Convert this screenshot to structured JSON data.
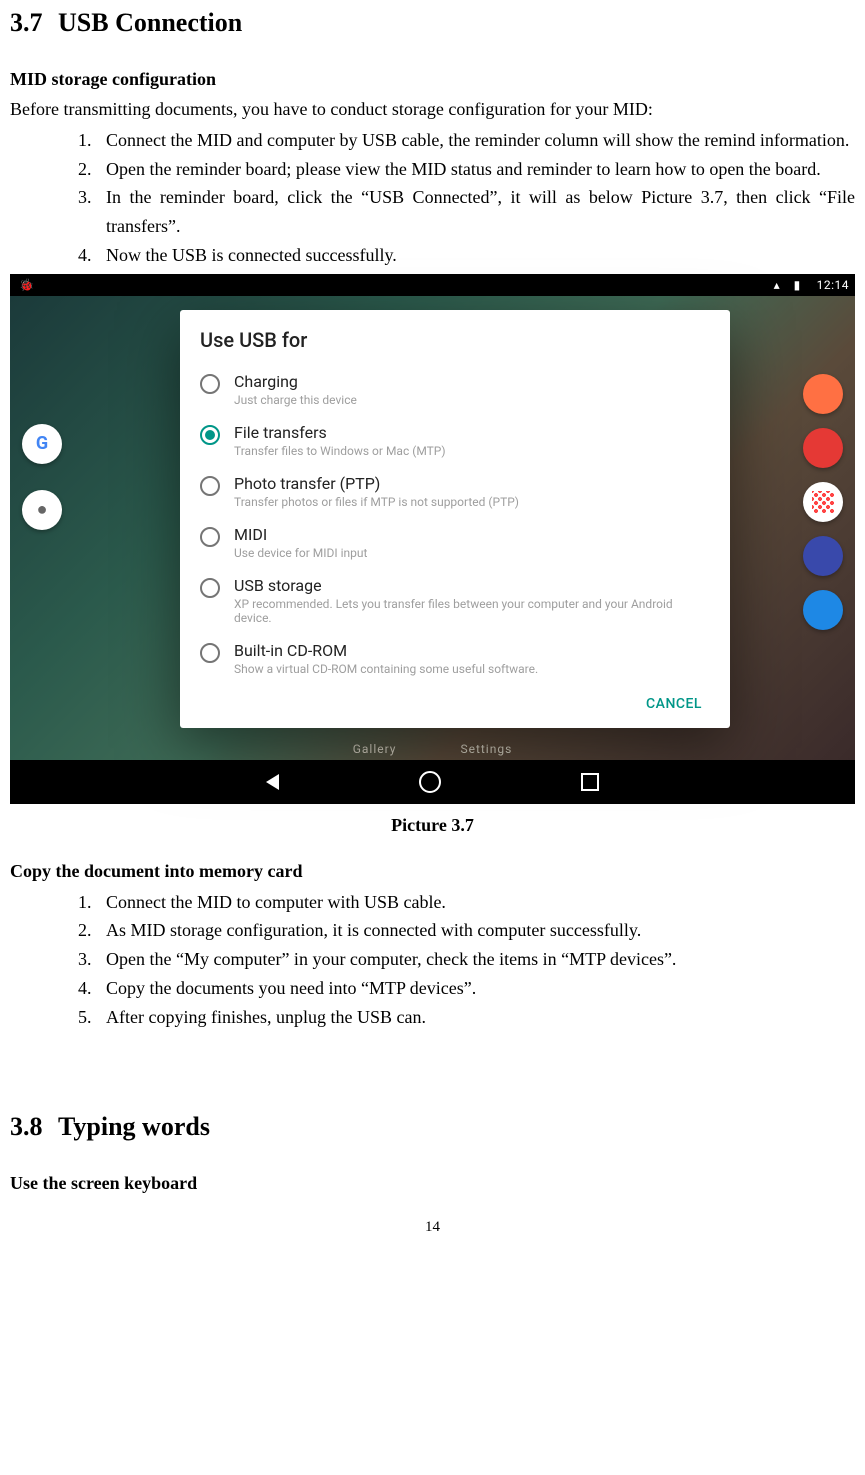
{
  "sec37": {
    "number": "3.7",
    "title": "USB Connection",
    "subhead1": "MID storage configuration",
    "intro": "Before transmitting documents, you have to conduct storage configuration for your MID:",
    "list1": [
      "Connect the MID and computer by USB cable, the reminder column will show the remind information.",
      "Open the reminder board; please view the MID status and reminder to learn how to open the board.",
      "In the reminder board, click the “USB Connected”, it will as below Picture 3.7, then click “File transfers”.",
      "Now the USB is connected successfully."
    ],
    "caption": "Picture 3.7",
    "subhead2": "Copy the document into memory card",
    "list2": [
      "Connect the MID to computer with USB cable.",
      "As MID storage configuration, it is connected with computer successfully.",
      "Open the “My computer” in your computer, check the items in “MTP devices”.",
      "Copy the documents you need into “MTP devices”.",
      "After copying finishes, unplug the USB can."
    ]
  },
  "sec38": {
    "number": "3.8",
    "title": "Typing words",
    "subhead": "Use the screen keyboard"
  },
  "screenshot": {
    "time": "12:14",
    "dialog_title": "Use USB for",
    "options": [
      {
        "label": "Charging",
        "desc": "Just charge this device",
        "selected": false
      },
      {
        "label": "File transfers",
        "desc": "Transfer files to Windows or Mac (MTP)",
        "selected": true
      },
      {
        "label": "Photo transfer (PTP)",
        "desc": "Transfer photos or files if MTP is not supported (PTP)",
        "selected": false
      },
      {
        "label": "MIDI",
        "desc": "Use device for MIDI input",
        "selected": false
      },
      {
        "label": "USB storage",
        "desc": "XP recommended. Lets you transfer files between your computer and your Android device.",
        "selected": false
      },
      {
        "label": "Built-in CD-ROM",
        "desc": "Show a virtual CD-ROM containing some useful software.",
        "selected": false
      }
    ],
    "cancel": "CANCEL",
    "bg_label_gallery": "Gallery",
    "bg_label_settings": "Settings"
  },
  "page_number": "14"
}
